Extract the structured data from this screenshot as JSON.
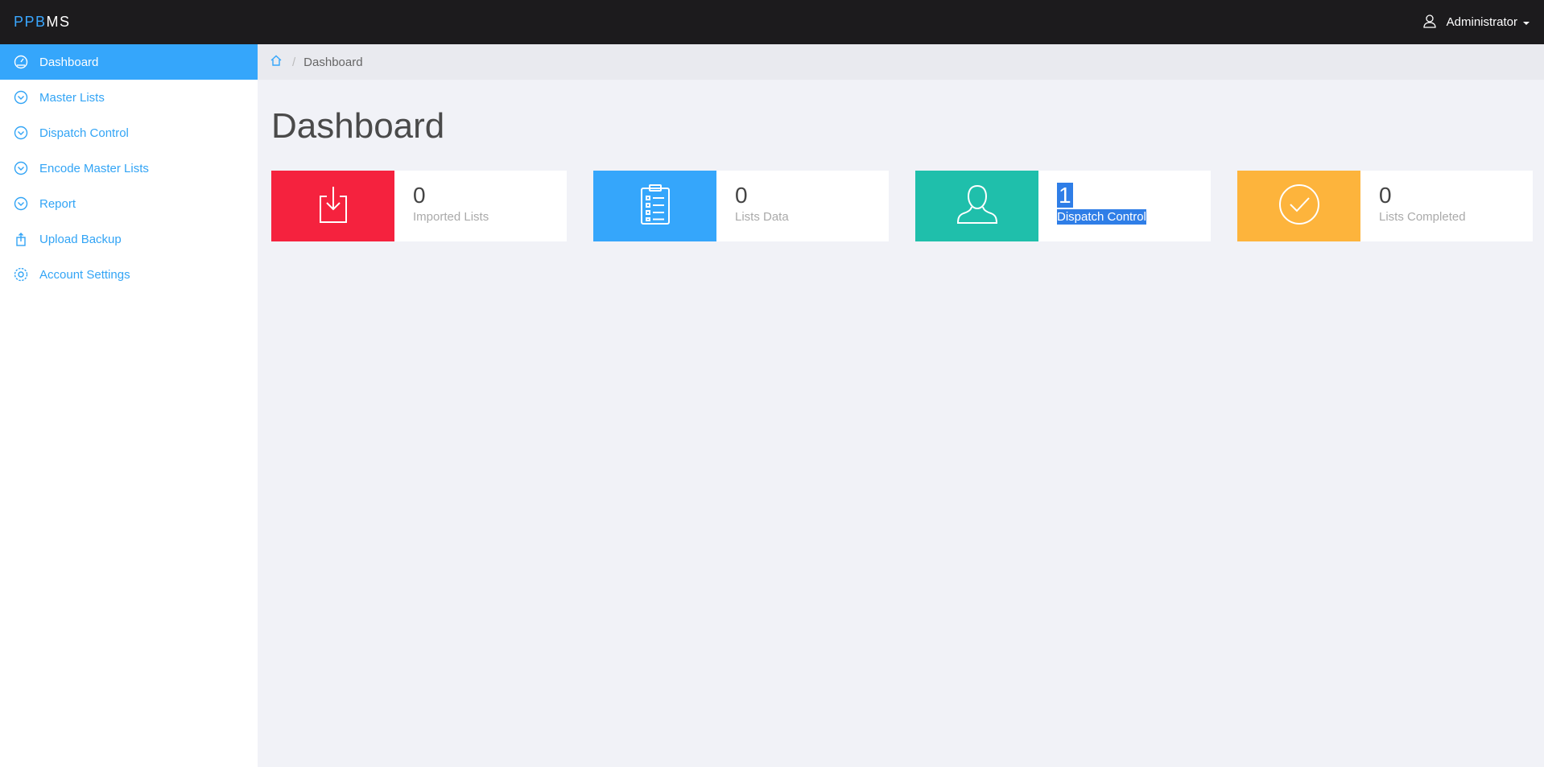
{
  "app": {
    "brand_part1": "PPB",
    "brand_part2": "MS"
  },
  "user": {
    "name": "Administrator"
  },
  "sidebar": {
    "items": [
      {
        "label": "Dashboard",
        "icon": "dashboard-icon",
        "active": true
      },
      {
        "label": "Master Lists",
        "icon": "chevron-down-circle-icon"
      },
      {
        "label": "Dispatch Control",
        "icon": "chevron-down-circle-icon"
      },
      {
        "label": "Encode Master Lists",
        "icon": "chevron-down-circle-icon"
      },
      {
        "label": "Report",
        "icon": "chevron-down-circle-icon"
      },
      {
        "label": "Upload Backup",
        "icon": "upload-icon"
      },
      {
        "label": "Account Settings",
        "icon": "gear-icon"
      }
    ]
  },
  "breadcrumb": {
    "home_icon": "home-icon",
    "current": "Dashboard"
  },
  "page": {
    "title": "Dashboard"
  },
  "cards": [
    {
      "value": "0",
      "label": "Imported Lists",
      "color": "#f5223e",
      "icon": "download-icon"
    },
    {
      "value": "0",
      "label": "Lists Data",
      "color": "#35a6fb",
      "icon": "clipboard-list-icon"
    },
    {
      "value": "1",
      "label": "Dispatch Control",
      "color": "#1fbfab",
      "icon": "user-icon",
      "text_selected": true
    },
    {
      "value": "0",
      "label": "Lists Completed",
      "color": "#fdb43c",
      "icon": "check-circle-icon"
    }
  ],
  "colors": {
    "topbar": "#1c1b1d",
    "accent": "#35a6fb",
    "background": "#f1f2f7"
  }
}
